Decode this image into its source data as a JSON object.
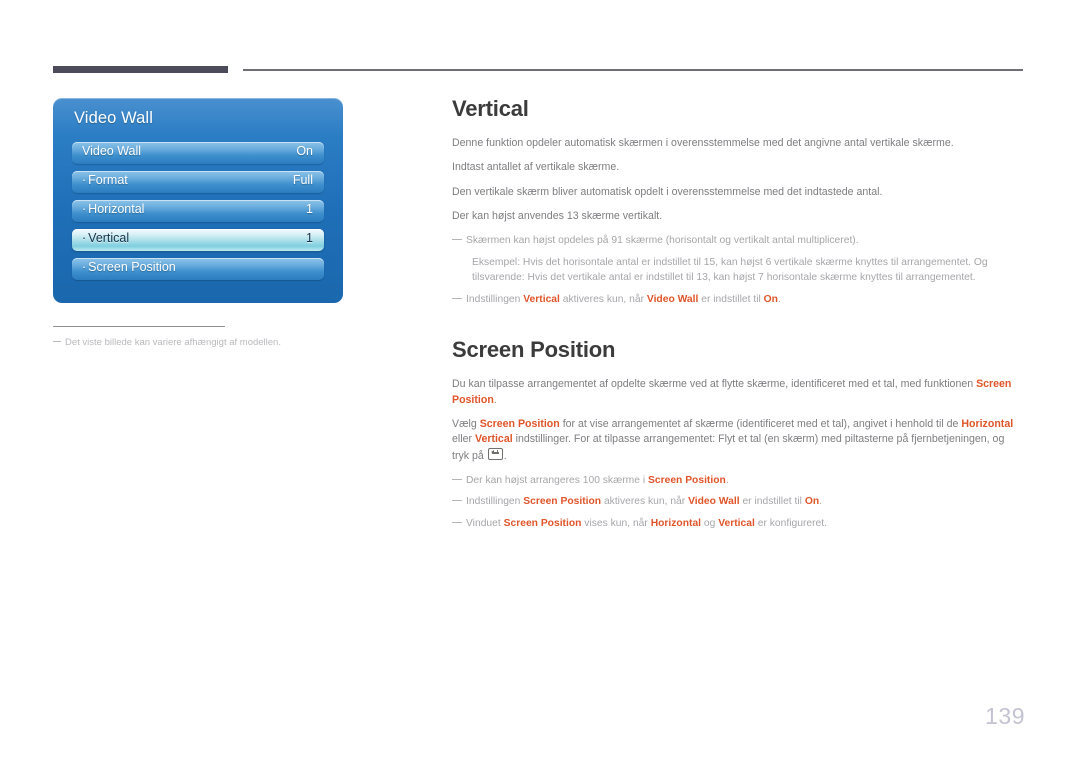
{
  "header": {
    "dark_rule": "",
    "thin_rule": ""
  },
  "osd": {
    "title": "Video Wall",
    "rows": [
      {
        "bullet": "",
        "label": "Video Wall",
        "value": "On",
        "highlight": false
      },
      {
        "bullet": "·",
        "label": "Format",
        "value": "Full",
        "highlight": false
      },
      {
        "bullet": "·",
        "label": "Horizontal",
        "value": "1",
        "highlight": false
      },
      {
        "bullet": "·",
        "label": "Vertical",
        "value": "1",
        "highlight": true
      },
      {
        "bullet": "·",
        "label": "Screen Position",
        "value": "",
        "highlight": false
      }
    ]
  },
  "left_footnote": {
    "text": "Det viste billede kan variere afhængigt af modellen."
  },
  "vertical_section": {
    "title": "Vertical",
    "paragraphs": [
      "Denne funktion opdeler automatisk skærmen i overensstemmelse med det angivne antal vertikale skærme.",
      "Indtast antallet af vertikale skærme.",
      "Den vertikale skærm bliver automatisk opdelt i overensstemmelse med det indtastede antal.",
      "Der kan højst anvendes 13 skærme vertikalt."
    ],
    "note1_line1": "Skærmen kan højst opdeles på 91 skærme (horisontalt og vertikalt antal multipliceret).",
    "note1_line2": "Eksempel: Hvis det horisontale antal er indstillet til 15, kan højst 6 vertikale skærme knyttes til arrangementet. Og tilsvarende: Hvis det vertikale antal er indstillet til 13, kan højst 7 horisontale skærme knyttes til arrangementet.",
    "note2": {
      "pre": "Indstillingen ",
      "t1": "Vertical",
      "mid": " aktiveres kun, når ",
      "t2": "Video Wall",
      "mid2": " er indstillet til ",
      "t3": "On",
      "post": "."
    }
  },
  "screen_position_section": {
    "title": "Screen Position",
    "p1": {
      "pre": "Du kan tilpasse arrangementet af opdelte skærme ved at flytte skærme, identificeret med et tal, med funktionen ",
      "t1": "Screen Position",
      "post": "."
    },
    "p2": {
      "pre": "Vælg ",
      "t1": "Screen Position",
      "mid1": " for at vise arrangementet af skærme (identificeret med et tal), angivet i henhold til de ",
      "t2": "Horizontal",
      "mid2": " eller ",
      "t3": "Vertical",
      "mid3": " indstillinger. For at tilpasse arrangementet: Flyt et tal (en skærm) med piltasterne på fjernbetjeningen, og tryk på ",
      "post": "."
    },
    "note1": {
      "pre": "Der kan højst arrangeres 100 skærme i ",
      "t1": "Screen Position",
      "post": "."
    },
    "note2": {
      "pre": "Indstillingen ",
      "t1": "Screen Position",
      "mid1": " aktiveres kun, når ",
      "t2": "Video Wall",
      "mid2": " er indstillet til ",
      "t3": "On",
      "post": "."
    },
    "note3": {
      "pre": "Vinduet ",
      "t1": "Screen Position",
      "mid1": " vises kun, når ",
      "t2": "Horizontal",
      "mid2": " og ",
      "t3": "Vertical",
      "mid3": " er konfigureret.",
      "post": ""
    }
  },
  "page": {
    "number": "139"
  },
  "colors": {
    "accent_orange": "#e0552a",
    "panel_blue": "#1f6fb8",
    "header_dark": "#4b4b5a",
    "body_text": "#7e7e82",
    "note_text": "#a6a6aa",
    "page_number": "#c3c3d2"
  }
}
